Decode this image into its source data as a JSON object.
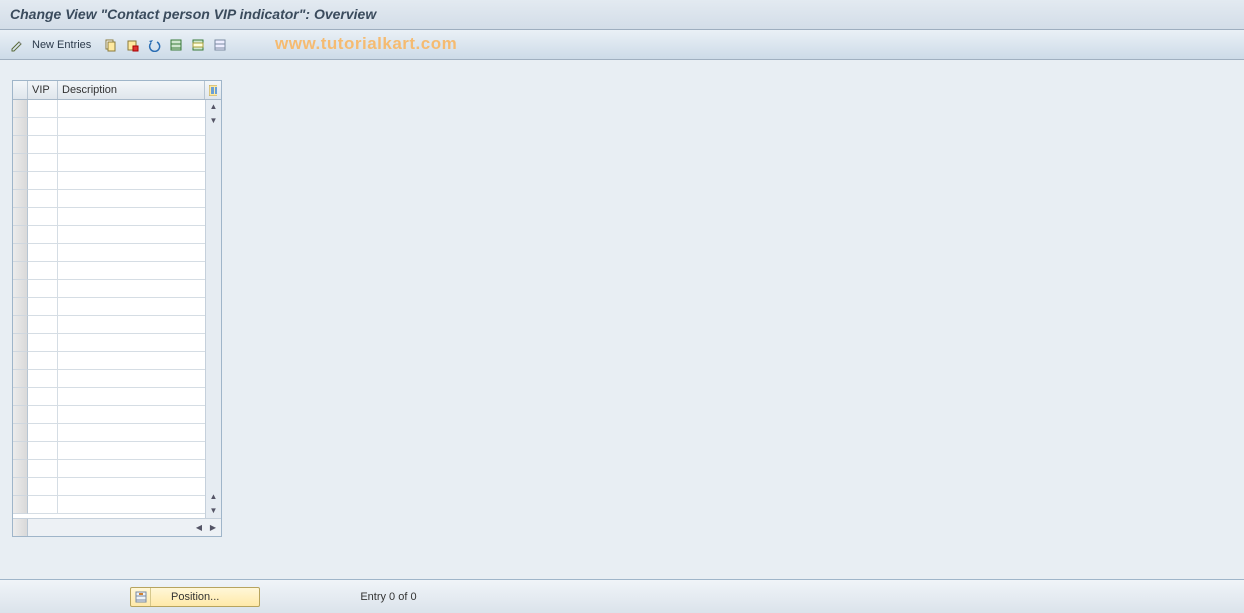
{
  "title": "Change View \"Contact person VIP indicator\": Overview",
  "toolbar": {
    "new_entries_label": "New Entries"
  },
  "watermark_text": "www.tutorialkart.com",
  "table": {
    "col_vip": "VIP",
    "col_desc": "Description",
    "row_count": 23
  },
  "footer": {
    "position_label": "Position...",
    "entry_text": "Entry 0 of 0"
  }
}
